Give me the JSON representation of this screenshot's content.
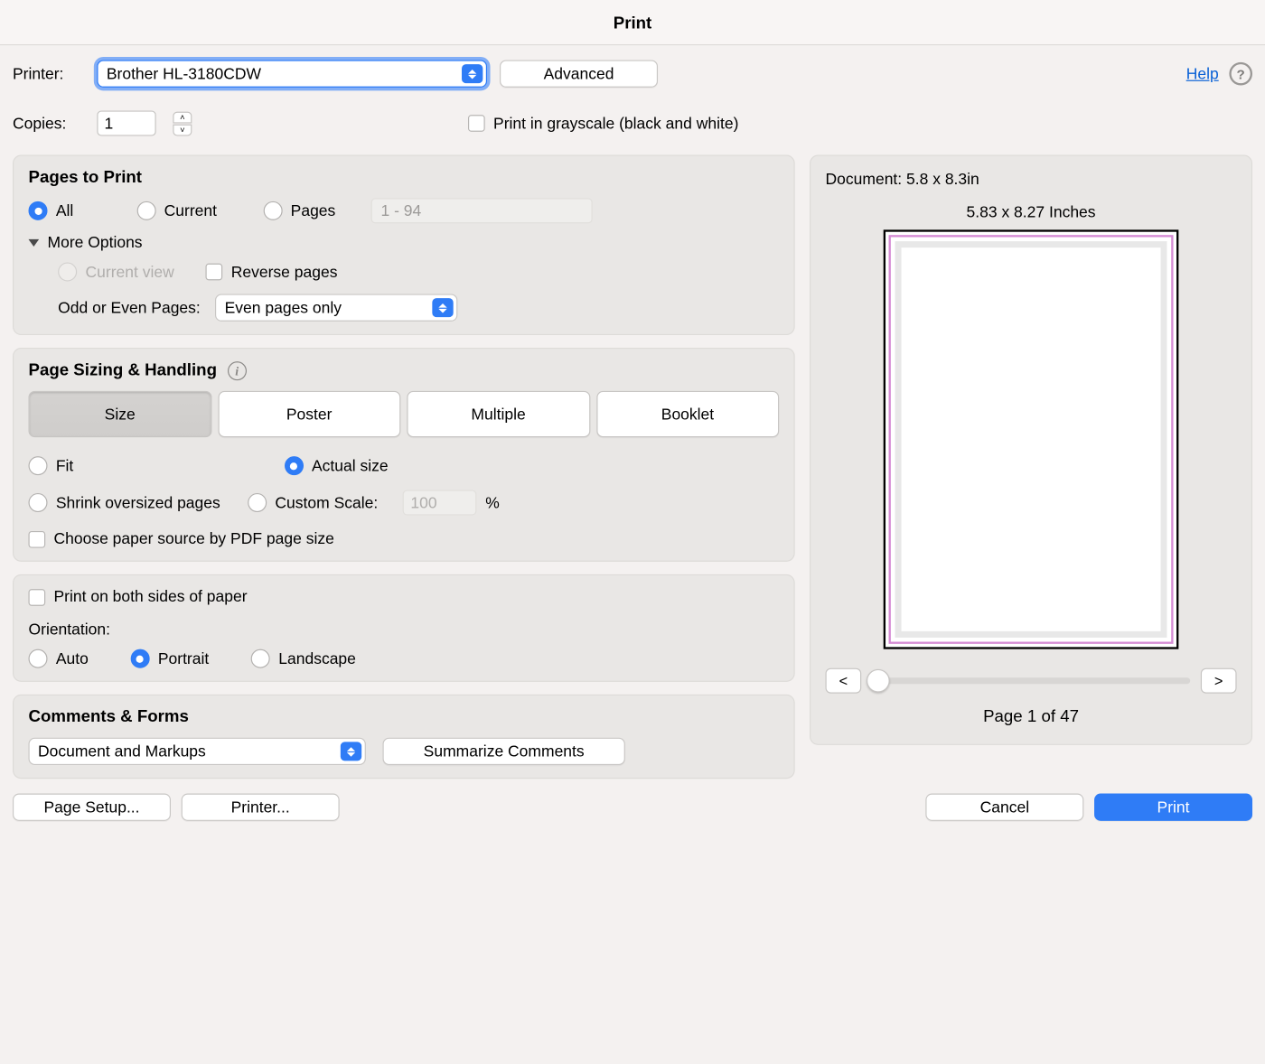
{
  "title": "Print",
  "help_link": "Help",
  "printer": {
    "label": "Printer:",
    "selected": "Brother HL-3180CDW",
    "advanced_btn": "Advanced"
  },
  "copies": {
    "label": "Copies:",
    "value": "1",
    "grayscale_label": "Print in grayscale (black and white)"
  },
  "pages_to_print": {
    "title": "Pages to Print",
    "all": "All",
    "current": "Current",
    "pages": "Pages",
    "range_placeholder": "1 - 94",
    "more_options": "More Options",
    "current_view": "Current view",
    "reverse_pages": "Reverse pages",
    "odd_even_label": "Odd or Even Pages:",
    "odd_even_value": "Even pages only"
  },
  "sizing": {
    "title": "Page Sizing & Handling",
    "tabs": {
      "size": "Size",
      "poster": "Poster",
      "multiple": "Multiple",
      "booklet": "Booklet"
    },
    "fit": "Fit",
    "actual": "Actual size",
    "shrink": "Shrink oversized pages",
    "custom_scale": "Custom Scale:",
    "custom_scale_value": "100",
    "percent": "%",
    "choose_paper": "Choose paper source by PDF page size"
  },
  "duplex": {
    "both_sides": "Print on both sides of paper",
    "orientation_label": "Orientation:",
    "auto": "Auto",
    "portrait": "Portrait",
    "landscape": "Landscape"
  },
  "comments": {
    "title": "Comments & Forms",
    "dropdown": "Document and Markups",
    "summarize": "Summarize Comments"
  },
  "preview": {
    "doc_dims": "Document: 5.8 x 8.3in",
    "paper_dims": "5.83 x 8.27 Inches",
    "page_of": "Page 1 of 47",
    "prev": "<",
    "next": ">"
  },
  "buttons": {
    "page_setup": "Page Setup...",
    "printer": "Printer...",
    "cancel": "Cancel",
    "print": "Print"
  }
}
